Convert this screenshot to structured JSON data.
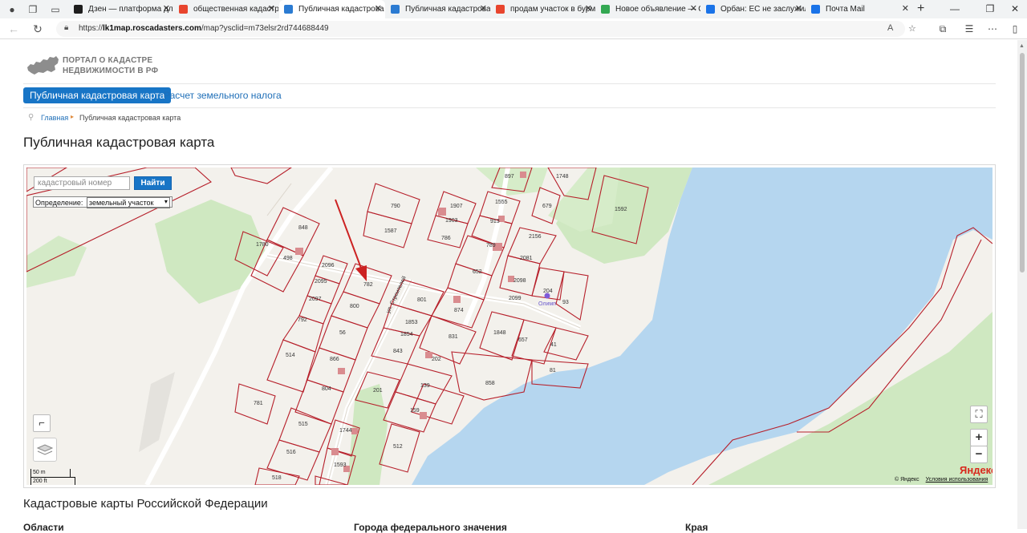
{
  "browser": {
    "tabs": [
      {
        "title": "Дзен — платформа для и",
        "favicon_color": "#1e1e1e"
      },
      {
        "title": "общественная кадастров",
        "favicon_color": "#e8452e"
      },
      {
        "title": "Публичная кадастрова",
        "favicon_color": "#2b7bd2",
        "active": true
      },
      {
        "title": "Публичная кадастровая к",
        "favicon_color": "#2b7bd2"
      },
      {
        "title": "продам участок в бурм",
        "favicon_color": "#e8452e"
      },
      {
        "title": "Новое объявление — Ог",
        "favicon_color": "#33a852"
      },
      {
        "title": "Орбан: ЕС не заслужил к",
        "favicon_color": "#1a73e8"
      },
      {
        "title": "Почта Mail",
        "favicon_color": "#1a73e8"
      }
    ],
    "url_prefix": "https://",
    "url_host": "lk1map.roscadasters.com",
    "url_path": "/map?ysclid=m73elsr2rd744688449"
  },
  "header": {
    "logo_line1": "ПОРТАЛ О КАДАСТРЕ",
    "logo_line2": "НЕДВИЖИМОСТИ В РФ",
    "nav": [
      {
        "label": "Публичная кадастровая карта",
        "active": true
      },
      {
        "label": "Расчет земельного налога",
        "active": false
      }
    ]
  },
  "breadcrumb": {
    "home": "Главная",
    "current": "Публичная кадастровая карта"
  },
  "page_title": "Публичная кадастровая карта",
  "map": {
    "search_placeholder": "кадастровый номер",
    "find_label": "Найти",
    "definition_label": "Определение:",
    "definition_value": "земельный участок",
    "scale_m": "50 m",
    "scale_ft": "200 ft",
    "yandex_logo": "Яндекс",
    "copyright": "© Яндекс",
    "terms": "Условия использования",
    "street_label": "ул. Строителей",
    "poi_label": "Олимп",
    "zoom_in": "+",
    "zoom_out": "−",
    "parcel_labels": [
      "897",
      "1748",
      "790",
      "1907",
      "1555",
      "679",
      "1592",
      "848",
      "1903",
      "913",
      "1587",
      "786",
      "2156",
      "1780",
      "789",
      "498",
      "2081",
      "2096",
      "652",
      "782",
      "2098",
      "2095",
      "204",
      "2099",
      "93",
      "2097",
      "801",
      "874",
      "800",
      "1853",
      "792",
      "56",
      "1854",
      "1848",
      "831",
      "657",
      "41",
      "514",
      "843",
      "202",
      "866",
      "81",
      "858",
      "804",
      "139",
      "201",
      "781",
      "159",
      "515",
      "1744",
      "512",
      "516",
      "1593",
      "518"
    ]
  },
  "section_title": "Кадастровые карты Российской Федерации",
  "columns": [
    "Области",
    "Города федерального значения",
    "Края"
  ]
}
